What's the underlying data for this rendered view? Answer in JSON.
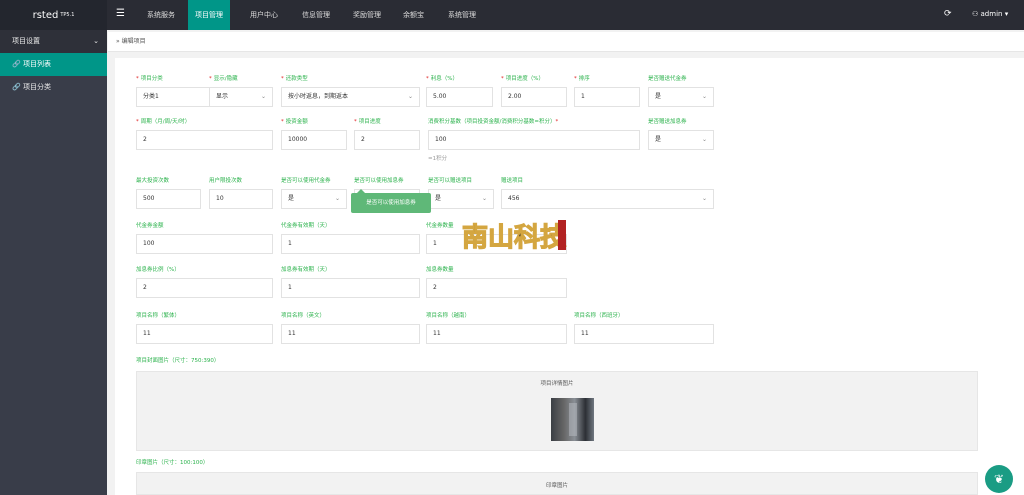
{
  "app": {
    "name": "rsted",
    "version": "TP5.1"
  },
  "topnav": {
    "menu_icon": "hamburger-icon",
    "items": [
      {
        "label": "系统服务",
        "active": false
      },
      {
        "label": "项目管理",
        "active": true
      },
      {
        "label": "用户中心",
        "active": false
      },
      {
        "label": "信息管理",
        "active": false
      },
      {
        "label": "奖励管理",
        "active": false
      },
      {
        "label": "余额宝",
        "active": false
      },
      {
        "label": "系统管理",
        "active": false
      }
    ],
    "refresh_icon": "refresh-icon",
    "user_icon": "user-icon",
    "user": "admin",
    "user_menu_icon": "chevron-down-icon"
  },
  "sidebar": {
    "header": "项目设置",
    "items": [
      {
        "label": "项目列表",
        "icon": "link-icon",
        "active": true
      },
      {
        "label": "项目分类",
        "icon": "link-icon",
        "active": false
      }
    ]
  },
  "breadcrumb": "编辑项目",
  "form": {
    "category": {
      "label": "项目分类",
      "value": "分类1"
    },
    "display": {
      "label": "显示/隐藏",
      "value": "显示"
    },
    "repay_type": {
      "label": "还款类型",
      "value": "按小时返息，到期返本"
    },
    "rate": {
      "label": "利息（%）",
      "value": "5.00"
    },
    "progress": {
      "label": "项目进度（%）",
      "value": "2.00"
    },
    "sort": {
      "label": "排序",
      "value": "1"
    },
    "give_coupon": {
      "label": "是否赠送代金券",
      "value": "是"
    },
    "period": {
      "label": "周期（月/周/天/时）",
      "value": "2"
    },
    "total_amount": {
      "label": "投资金额",
      "value": "10000"
    },
    "project_level": {
      "label": "项目进度",
      "value": "2"
    },
    "points": {
      "label": "消费积分基数（项目投资金额/消费积分基数=积分）",
      "value": "100",
      "hint": "=1积分"
    },
    "give_addition": {
      "label": "是否赠送加息券",
      "value": "是"
    },
    "max_invest": {
      "label": "最大投资次数",
      "value": "500"
    },
    "user_limit": {
      "label": "用户限投次数",
      "value": "10"
    },
    "use_coupon": {
      "label": "是否可以使用代金券",
      "value": "是"
    },
    "use_addition": {
      "label": "是否可以使用加息券",
      "value": "是"
    },
    "give_project": {
      "label": "是否可以赠送项目",
      "value": "是"
    },
    "gift_project": {
      "label": "赠送项目",
      "value": "456"
    },
    "coupon_amount": {
      "label": "代金券金额",
      "value": "100"
    },
    "coupon_days": {
      "label": "代金券有效期（天）",
      "value": "1"
    },
    "coupon_count": {
      "label": "代金券数量",
      "value": "1"
    },
    "addition_rate": {
      "label": "加息券比例（%）",
      "value": "2"
    },
    "addition_days": {
      "label": "加息券有效期（天）",
      "value": "1"
    },
    "addition_count": {
      "label": "加息券数量",
      "value": "2"
    },
    "name_cn": {
      "label": "项目名称（繁体）",
      "value": "11"
    },
    "name_en": {
      "label": "项目名称（英文）",
      "value": "11"
    },
    "name_vi": {
      "label": "项目名称（越南）",
      "value": "11"
    },
    "name_es": {
      "label": "项目名称（西班牙）",
      "value": "11"
    },
    "cover": {
      "label": "项目封面图片（尺寸：750:390）",
      "upload_text": "项目详情图片"
    },
    "logo": {
      "label": "印章图片（尺寸：100:100）",
      "upload_text": "印章图片"
    }
  },
  "tooltip": "是否可以使用加息券",
  "watermark": {
    "text": "南山科技"
  },
  "colors": {
    "accent": "#009688",
    "label_green": "#2bb24c",
    "required": "#e02020",
    "sidebar": "#393d49",
    "topbar": "#2a2c34"
  }
}
